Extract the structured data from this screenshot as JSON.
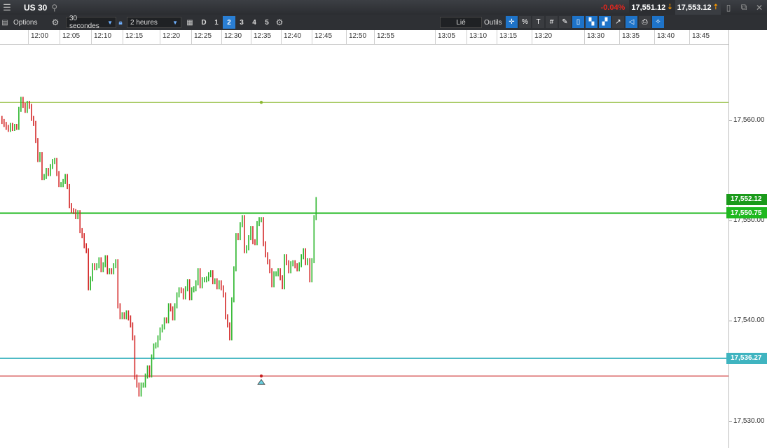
{
  "window": {
    "symbol": "US 30"
  },
  "quote": {
    "change_pct": "-0.04%",
    "bid": "17,551.12",
    "ask": "17,553.12"
  },
  "toolbar": {
    "options_label": "Options",
    "interval": "30 secondes",
    "range": "2 heures",
    "periods": [
      "D",
      "1",
      "2",
      "3",
      "4",
      "5"
    ],
    "active_period": "2",
    "linked_label": "Lié",
    "tools_label": "Outils"
  },
  "colors": {
    "up": "#2ab52a",
    "down": "#d42a2a",
    "line_green": "#1fb81f",
    "line_olive": "#8cb832",
    "line_teal": "#3fb4c0",
    "line_red": "#c81e1e"
  },
  "chart_data": {
    "type": "bar",
    "title": "",
    "xlabel": "",
    "ylabel": "",
    "x_ticks": [
      "12:00",
      "12:05",
      "12:10",
      "12:15",
      "12:20",
      "12:25",
      "12:30",
      "12:35",
      "12:40",
      "12:45",
      "12:50",
      "12:55",
      "13:05",
      "13:10",
      "13:15",
      "13:20",
      "13:30",
      "13:35",
      "13:40",
      "13:45"
    ],
    "y_ticks": [
      "17,560.00",
      "17,550.00",
      "17,540.00",
      "17,530.00"
    ],
    "ylim": [
      17527.3,
      17567.6
    ],
    "horizontal_lines": [
      {
        "price": 17561.8,
        "color": "olive"
      },
      {
        "price": 17550.75,
        "label": "17,550.75",
        "color": "green"
      },
      {
        "price": 17536.27,
        "label": "17,536.27",
        "color": "teal"
      },
      {
        "price": 17534.5,
        "color": "red"
      }
    ],
    "last_price": {
      "label": "17,552.12",
      "value": 17552.12
    },
    "close_prices": [
      17559.9,
      17559.6,
      17559.3,
      17559.1,
      17559.5,
      17559.2,
      17559.4,
      17559.3,
      17561.1,
      17562.1,
      17561.5,
      17561.0,
      17561.7,
      17561.4,
      17560.2,
      17559.7,
      17558.0,
      17556.1,
      17556.6,
      17554.3,
      17554.4,
      17555.0,
      17554.7,
      17555.4,
      17555.9,
      17556.0,
      17554.7,
      17553.6,
      17553.6,
      17553.9,
      17554.4,
      17553.4,
      17551.5,
      17551.0,
      17550.9,
      17550.4,
      17550.8,
      17549.0,
      17548.5,
      17547.5,
      17547.0,
      17543.3,
      17544.2,
      17545.5,
      17545.3,
      17545.5,
      17546.1,
      17545.1,
      17545.6,
      17546.3,
      17544.9,
      17545.0,
      17544.9,
      17545.5,
      17545.9,
      17541.5,
      17540.4,
      17540.6,
      17540.4,
      17540.8,
      17540.3,
      17539.6,
      17538.3,
      17534.4,
      17533.6,
      17532.7,
      17533.6,
      17533.6,
      17534.5,
      17535.3,
      17534.6,
      17536.4,
      17537.5,
      17537.6,
      17538.3,
      17539.1,
      17539.4,
      17540.1,
      17540.0,
      17541.5,
      17541.2,
      17540.3,
      17541.5,
      17542.6,
      17543.1,
      17543.0,
      17542.4,
      17543.2,
      17543.9,
      17542.3,
      17543.1,
      17543.2,
      17543.8,
      17545.0,
      17543.5,
      17544.1,
      17544.1,
      17544.2,
      17544.6,
      17544.8,
      17543.9,
      17544.0,
      17543.4,
      17543.8,
      17543.3,
      17542.6,
      17540.4,
      17539.6,
      17538.3,
      17542.1,
      17545.2,
      17548.5,
      17548.3,
      17549.6,
      17550.3,
      17547.0,
      17547.3,
      17548.3,
      17549.2,
      17547.9,
      17547.8,
      17549.7,
      17550.1,
      17550.1,
      17547.7,
      17546.6,
      17545.9,
      17545.0,
      17543.6,
      17544.7,
      17544.7,
      17545.0,
      17544.3,
      17543.4,
      17546.4,
      17545.8,
      17545.0,
      17545.7,
      17545.8,
      17545.5,
      17545.2,
      17545.6,
      17546.4,
      17547.0,
      17545.8,
      17546.0,
      17544.1,
      17546.0,
      17550.3,
      17552.1
    ]
  }
}
